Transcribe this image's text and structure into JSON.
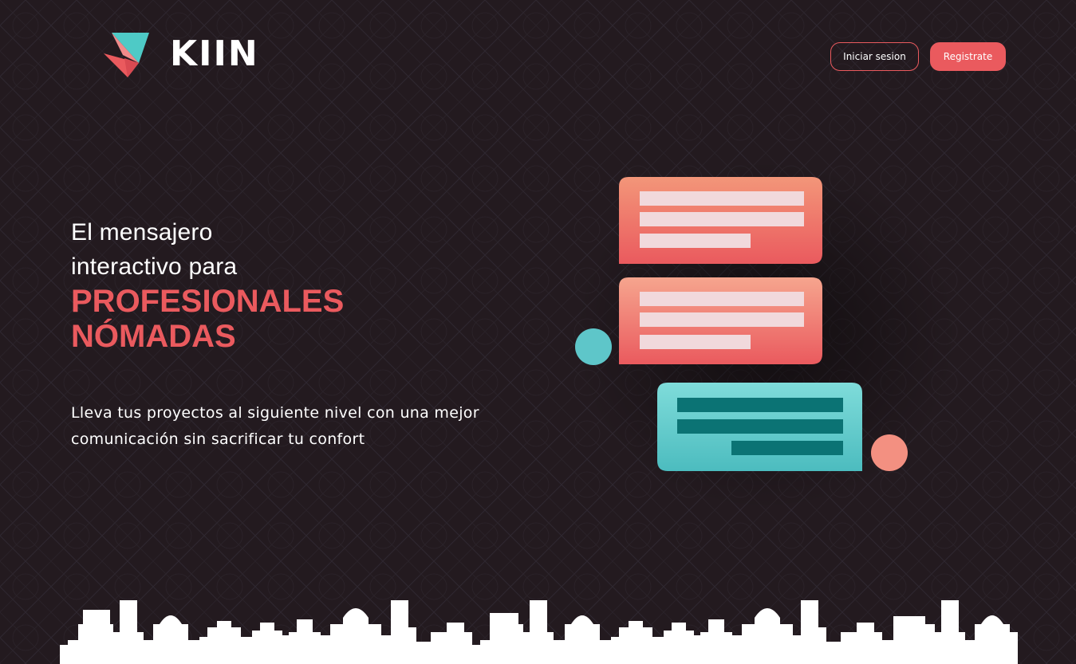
{
  "brand": {
    "name": "KIIN",
    "logo_colors": {
      "teal": "#4ecac6",
      "coral": "#ea5a5e",
      "pink": "#f08a8a"
    }
  },
  "header": {
    "login_label": "Iniciar sesion",
    "register_label": "Registrate"
  },
  "hero": {
    "line1": "El mensajero",
    "line2": "interactivo para",
    "accent1": "PROFESIONALES",
    "accent2": "NÓMADAS",
    "subtitle_line1": "Lleva tus proyectos al siguiente nivel con una mejor",
    "subtitle_line2": "comunicación sin sacrificar tu confort"
  },
  "illustration": {
    "bubble_colors": {
      "coral_top": "#f39679",
      "coral_bottom": "#ea5a5e",
      "teal_top": "#7fdcda",
      "teal_bottom": "#4cbcbf",
      "line_light": "#f1d9dc",
      "line_dark": "#0b7374"
    },
    "avatars": [
      "teal-avatar",
      "pink-avatar"
    ]
  },
  "colors": {
    "background": "#231a1f",
    "accent": "#ea5a5e",
    "text": "#ffffff"
  }
}
